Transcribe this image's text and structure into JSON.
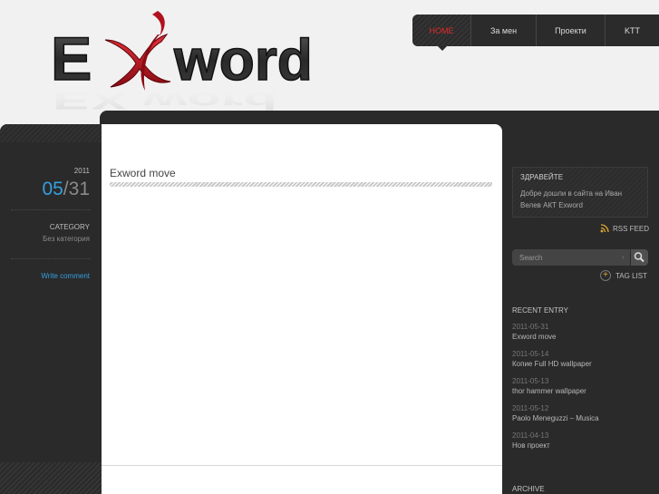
{
  "brand": {
    "logo_text": "Exword"
  },
  "nav": {
    "items": [
      {
        "label": "HOME",
        "active": true
      },
      {
        "label": "За мен",
        "active": false
      },
      {
        "label": "Проекти",
        "active": false
      },
      {
        "label": "KTT",
        "active": false
      }
    ]
  },
  "post": {
    "year": "2011",
    "month": "05",
    "date_sep": "/",
    "day": "31",
    "category_label": "CATEGORY",
    "category_value": "Без категория",
    "write_comment": "Write comment",
    "title": "Exword move"
  },
  "sidebar": {
    "welcome": {
      "title": "ЗДРАВЕЙТЕ",
      "text": "Добре дошли в сайта на Иван Велев АКТ Exword"
    },
    "rss_label": "RSS FEED",
    "search": {
      "placeholder": "Search"
    },
    "taglist_label": "TAG LIST",
    "recent_title": "RECENT ENTRY",
    "recent": [
      {
        "date": "2011-05-31",
        "title": "Exword move"
      },
      {
        "date": "2011-05-14",
        "title": "Копие Full HD wallpaper"
      },
      {
        "date": "2011-05-13",
        "title": "thor hammer wallpaper"
      },
      {
        "date": "2011-05-12",
        "title": "Paolo Meneguzzi – Musica"
      },
      {
        "date": "2011-04-13",
        "title": "Нов проект"
      }
    ],
    "archive_title": "ARCHIVE"
  },
  "icons": {
    "rss": "rss-icon",
    "search": "magnifier-icon",
    "taglist": "plus-circle-icon"
  },
  "colors": {
    "accent_blue": "#33a0e0",
    "nav_active_red": "#e02b2b",
    "logo_red": "#b0121d",
    "dark_bg": "#2a2a2a",
    "rss_yellow": "#e0a82e"
  }
}
